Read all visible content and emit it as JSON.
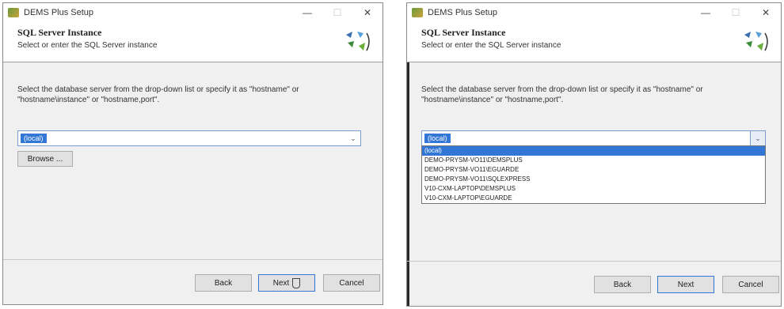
{
  "left_window": {
    "title": "DEMS Plus Setup",
    "header": {
      "title": "SQL Server Instance",
      "subtitle": "Select or enter the SQL Server instance"
    },
    "description": "Select the database server from the drop-down list or specify it as \"hostname\" or \"hostname\\instance\" or \"hostname,port\".",
    "instance_combo": {
      "value": "(local)"
    },
    "browse_label": "Browse ...",
    "footer": {
      "back": "Back",
      "next": "Next",
      "cancel": "Cancel"
    }
  },
  "right_window": {
    "title": "DEMS Plus Setup",
    "header": {
      "title": "SQL Server Instance",
      "subtitle": "Select or enter the SQL Server instance"
    },
    "description": "Select the database server from the drop-down list or specify it as \"hostname\" or \"hostname\\instance\" or \"hostname,port\".",
    "instance_combo": {
      "value": "(local)"
    },
    "dropdown_options": [
      "(local)",
      "DEMO-PRYSM-VO11\\DEMSPLUS",
      "DEMO-PRYSM-VO11\\EGUARDE",
      "DEMO-PRYSM-VO11\\SQLEXPRESS",
      "V10-CXM-LAPTOP\\DEMSPLUS",
      "V10-CXM-LAPTOP\\EGUARDE"
    ],
    "footer": {
      "back": "Back",
      "next": "Next",
      "cancel": "Cancel"
    }
  }
}
